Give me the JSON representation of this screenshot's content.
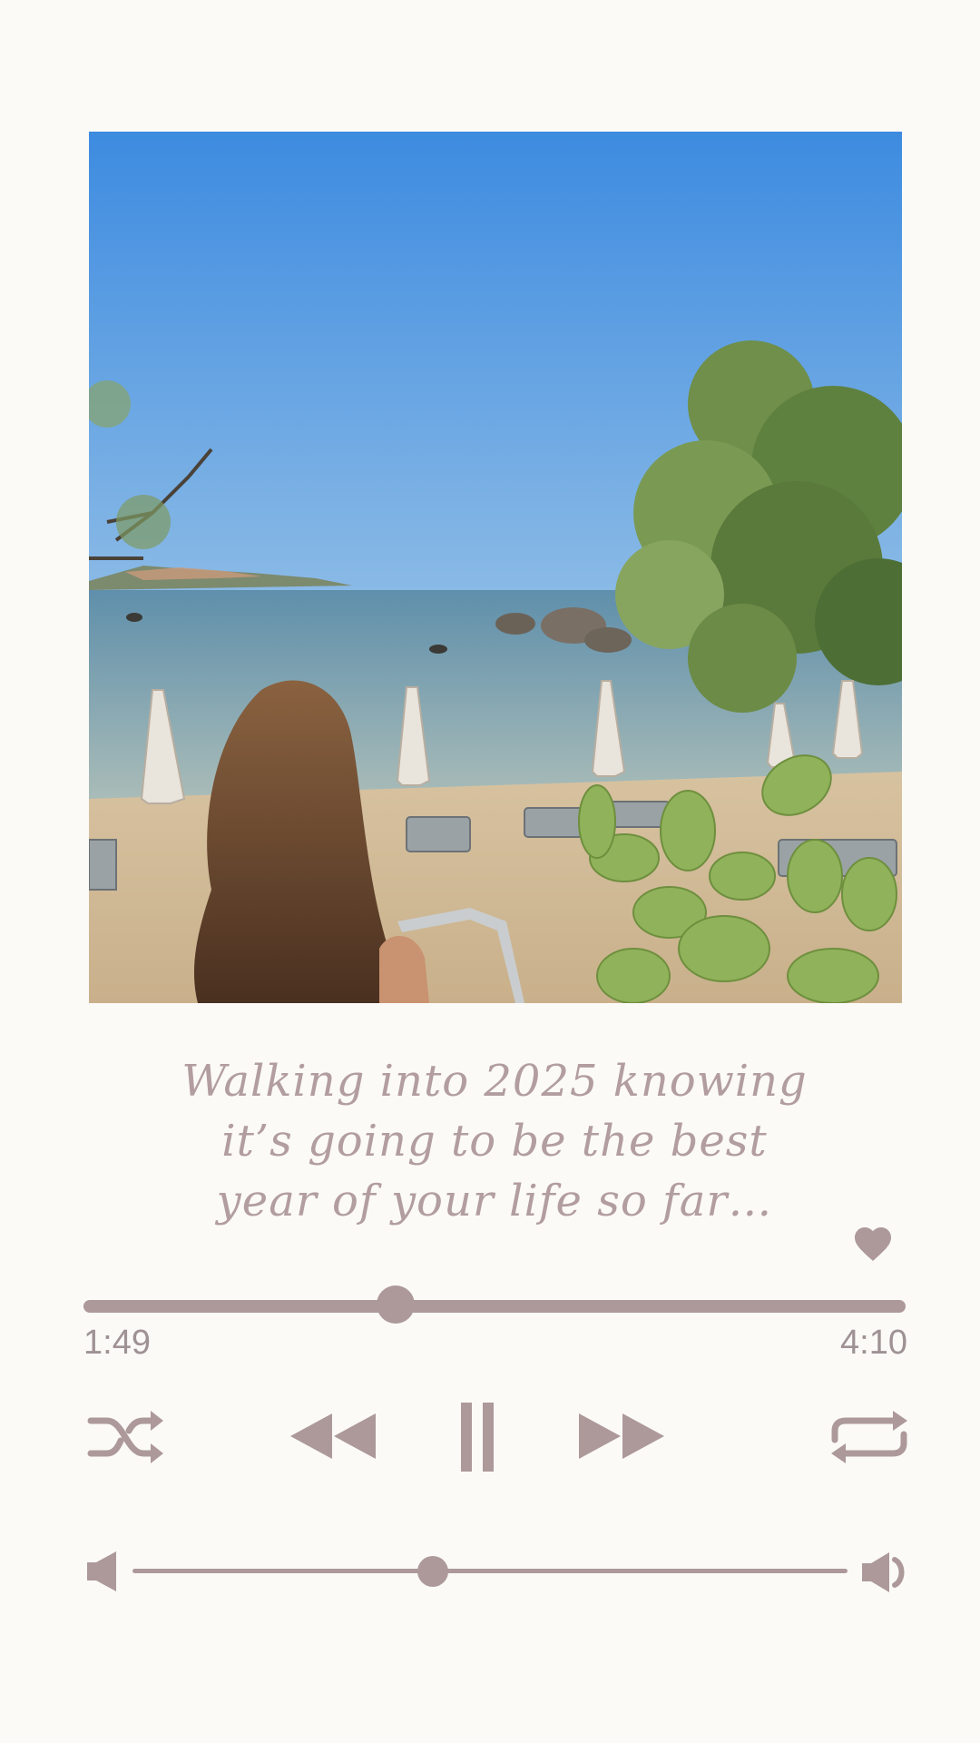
{
  "caption": {
    "line1": "Walking into 2025 knowing",
    "line2": "it’s going to be the best",
    "line3": "year of your life so far…"
  },
  "player": {
    "elapsed": "1:49",
    "total": "4:10",
    "progress_fraction": 0.38,
    "volume_fraction": 0.42,
    "liked": true,
    "playing": true
  },
  "icons": {
    "heart": "heart-icon",
    "shuffle": "shuffle-icon",
    "rewind": "rewind-icon",
    "pause": "pause-icon",
    "fast_forward": "fast-forward-icon",
    "repeat": "repeat-icon",
    "volume_low": "volume-low-icon",
    "volume_high": "volume-high-icon"
  },
  "colors": {
    "background": "#fbfaf7",
    "accent": "#ad999a",
    "caption_text": "#b29d9f",
    "time_text": "#9f9294"
  }
}
